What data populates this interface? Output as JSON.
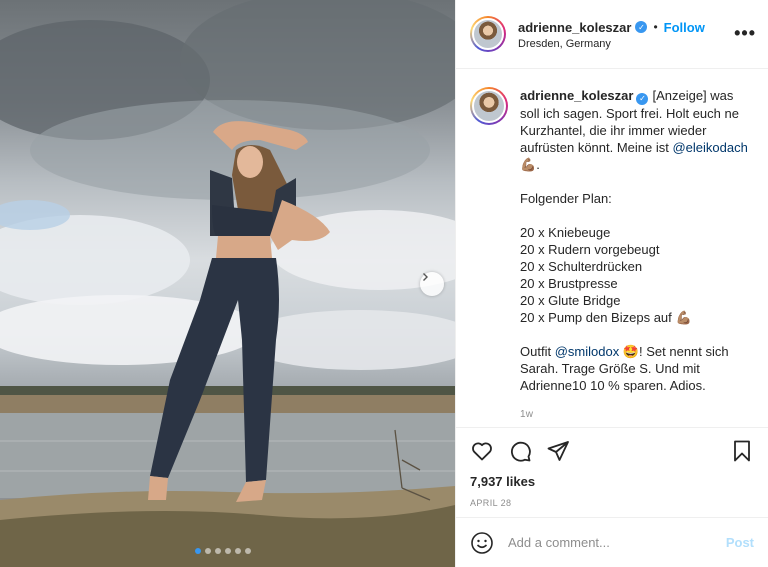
{
  "header": {
    "username": "adrienne_koleszar",
    "verified_mark": "✓",
    "separator": "•",
    "follow_label": "Follow",
    "location": "Dresden, Germany",
    "more_label": "•••"
  },
  "caption": {
    "username": "adrienne_koleszar",
    "line1": "[Anzeige] was soll ich sagen. Sport frei. Holt euch ne Kurzhantel, die ihr immer wieder aufrüsten könnt. Meine ist",
    "mention1": "@eleikodach",
    "emoji1": "💪🏽",
    "line1_end": ".",
    "plan_title": "Folgender Plan:",
    "plan": [
      "20 x Kniebeuge",
      "20 x Rudern vorgebeugt",
      "20 x Schulterdrücken",
      "20 x Brustpresse",
      "20 x Glute Bridge",
      "20 x Pump den Bizeps auf"
    ],
    "plan_emoji": "💪🏽",
    "outfit_prefix": "Outfit",
    "mention2": "@smilodox",
    "emoji2": "🤩",
    "outfit_text": "! Set nennt sich Sarah. Trage Größe S. Und mit Adrienne10 10 % sparen. Adios.",
    "time_ago": "1w"
  },
  "actions": {
    "icons": [
      "heart-icon",
      "comment-icon",
      "share-icon",
      "bookmark-icon"
    ],
    "likes": "7,937 likes",
    "date": "APRIL 28"
  },
  "comment": {
    "placeholder": "Add a comment...",
    "post_label": "Post"
  },
  "carousel": {
    "total": 6,
    "active_index": 0
  },
  "colors": {
    "accent": "#0095f6",
    "verified": "#3897f0",
    "mention": "#00376b",
    "muted": "#8e8e8e",
    "post_disabled": "#b2dffc"
  }
}
